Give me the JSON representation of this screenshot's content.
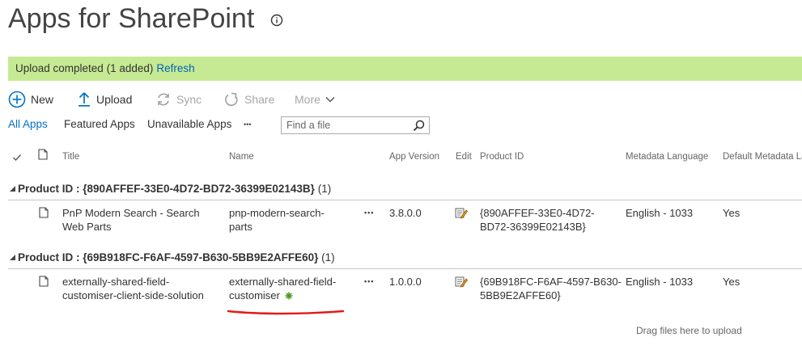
{
  "page": {
    "title": "Apps for SharePoint"
  },
  "banner": {
    "message": "Upload completed (1 added)",
    "refresh_label": "Refresh"
  },
  "commands": {
    "new_label": "New",
    "upload_label": "Upload",
    "sync_label": "Sync",
    "share_label": "Share",
    "more_label": "More"
  },
  "views": {
    "all": "All Apps",
    "featured": "Featured Apps",
    "unavailable": "Unavailable Apps",
    "overflow": "•••"
  },
  "search": {
    "placeholder": "Find a file"
  },
  "columns": {
    "title": "Title",
    "name": "Name",
    "app_version": "App Version",
    "edit": "Edit",
    "product_id": "Product ID",
    "metadata_language": "Metadata Language",
    "default_metadata_language": "Default Metadata La"
  },
  "groups": [
    {
      "label": "Product ID",
      "value": "{890AFFEF-33E0-4D72-BD72-36399E02143B}",
      "count": "(1)",
      "row": {
        "title_line1": "PnP Modern Search - Search",
        "title_line2": "Web Parts",
        "name_line1": "pnp-modern-search-",
        "name_line2": "parts",
        "actions": "•••",
        "version": "3.8.0.0",
        "product_id_line1": "{890AFFEF-33E0-4D72-",
        "product_id_line2": "BD72-36399E02143B}",
        "language": "English - 1033",
        "default": "Yes"
      }
    },
    {
      "label": "Product ID",
      "value": "{69B918FC-F6AF-4597-B630-5BB9E2AFFE60}",
      "count": "(1)",
      "row": {
        "title_line1": "externally-shared-field-",
        "title_line2": "customiser-client-side-solution",
        "name_line1": "externally-shared-field-",
        "name_line2": "customiser",
        "actions": "•••",
        "version": "1.0.0.0",
        "product_id_line1": "{69B918FC-F6AF-4597-B630-",
        "product_id_line2": "5BB9E2AFFE60}",
        "language": "English - 1033",
        "default": "Yes"
      }
    }
  ],
  "footer": {
    "drag_hint": "Drag files here to upload"
  },
  "colors": {
    "banner_bg": "#c6ea93",
    "link": "#0062b8",
    "accent": "#0072c6",
    "new_item_marker": "#4a9c1f",
    "annotation_underline": "#e21b1b"
  }
}
